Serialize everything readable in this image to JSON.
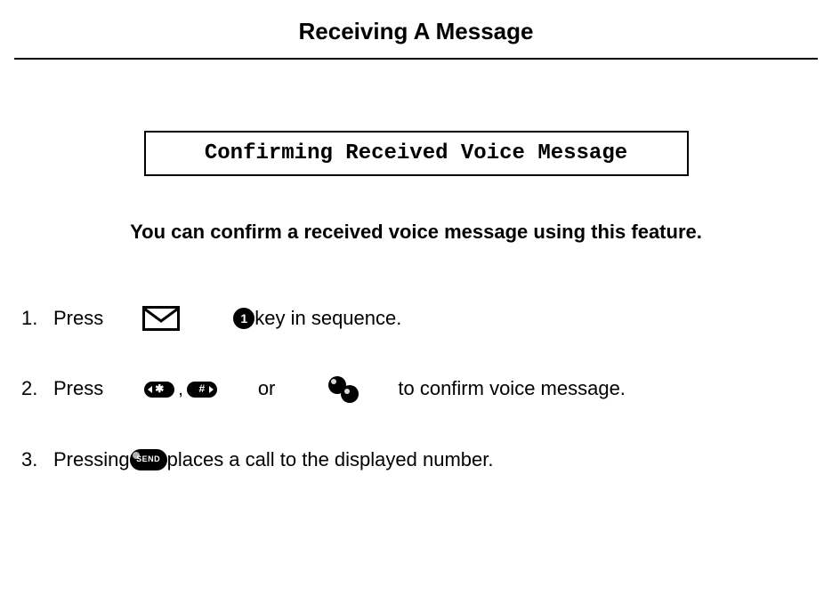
{
  "page_title": "Receiving A Message",
  "subtitle": "Confirming Received Voice Message",
  "intro": "You can confirm a received voice message using this feature.",
  "steps": {
    "s1": {
      "num": "1.",
      "press": "Press",
      "key_seq_tail": " key in sequence."
    },
    "s2": {
      "num": "2.",
      "press": "Press",
      "sep": ",",
      "or": "or",
      "tail": "to confirm voice message."
    },
    "s3": {
      "num": "3.",
      "pressing": "Pressing ",
      "tail": " places a call to the displayed number."
    }
  },
  "icons": {
    "envelope": "envelope-icon",
    "circled1": "1",
    "star_key": "✱",
    "hash_key": "#",
    "send_label": "SEND"
  }
}
